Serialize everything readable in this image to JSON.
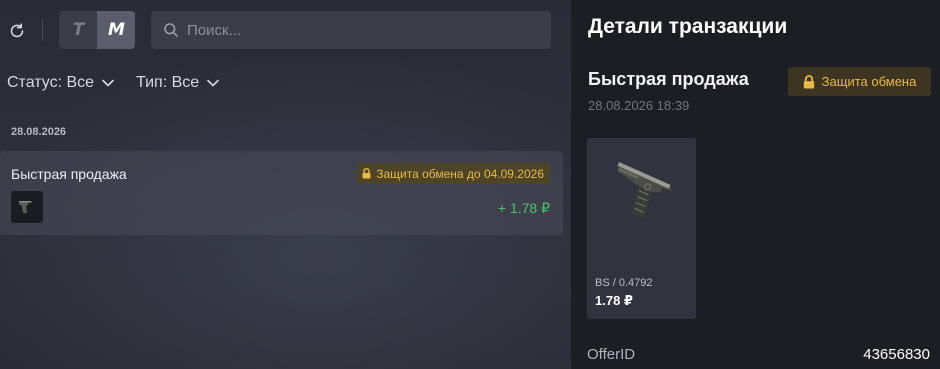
{
  "toolbar": {
    "refresh_icon": "refresh-icon",
    "brand_t": "T",
    "brand_m": "M",
    "search_placeholder": "Поиск..."
  },
  "filters": {
    "status_label": "Статус: Все",
    "type_label": "Тип: Все"
  },
  "transactions": {
    "date_heading": "28.08.2026",
    "items": [
      {
        "title": "Быстрая продажа",
        "badge": "Защита обмена до 04.09.2026",
        "amount": "+ 1.78 ₽"
      }
    ]
  },
  "details": {
    "header": "Детали транзакции",
    "sale_title": "Быстрая продажа",
    "badge": "Защита обмена",
    "date": "28.08.2026 18:39",
    "item": {
      "wear": "BS / 0.4792",
      "price": "1.78 ₽"
    },
    "offer_label": "OfferID",
    "offer_value": "43656830"
  },
  "colors": {
    "accent_gold": "#e9b949",
    "positive_green": "#4ec06a",
    "panel_dark": "#1d1d24"
  }
}
